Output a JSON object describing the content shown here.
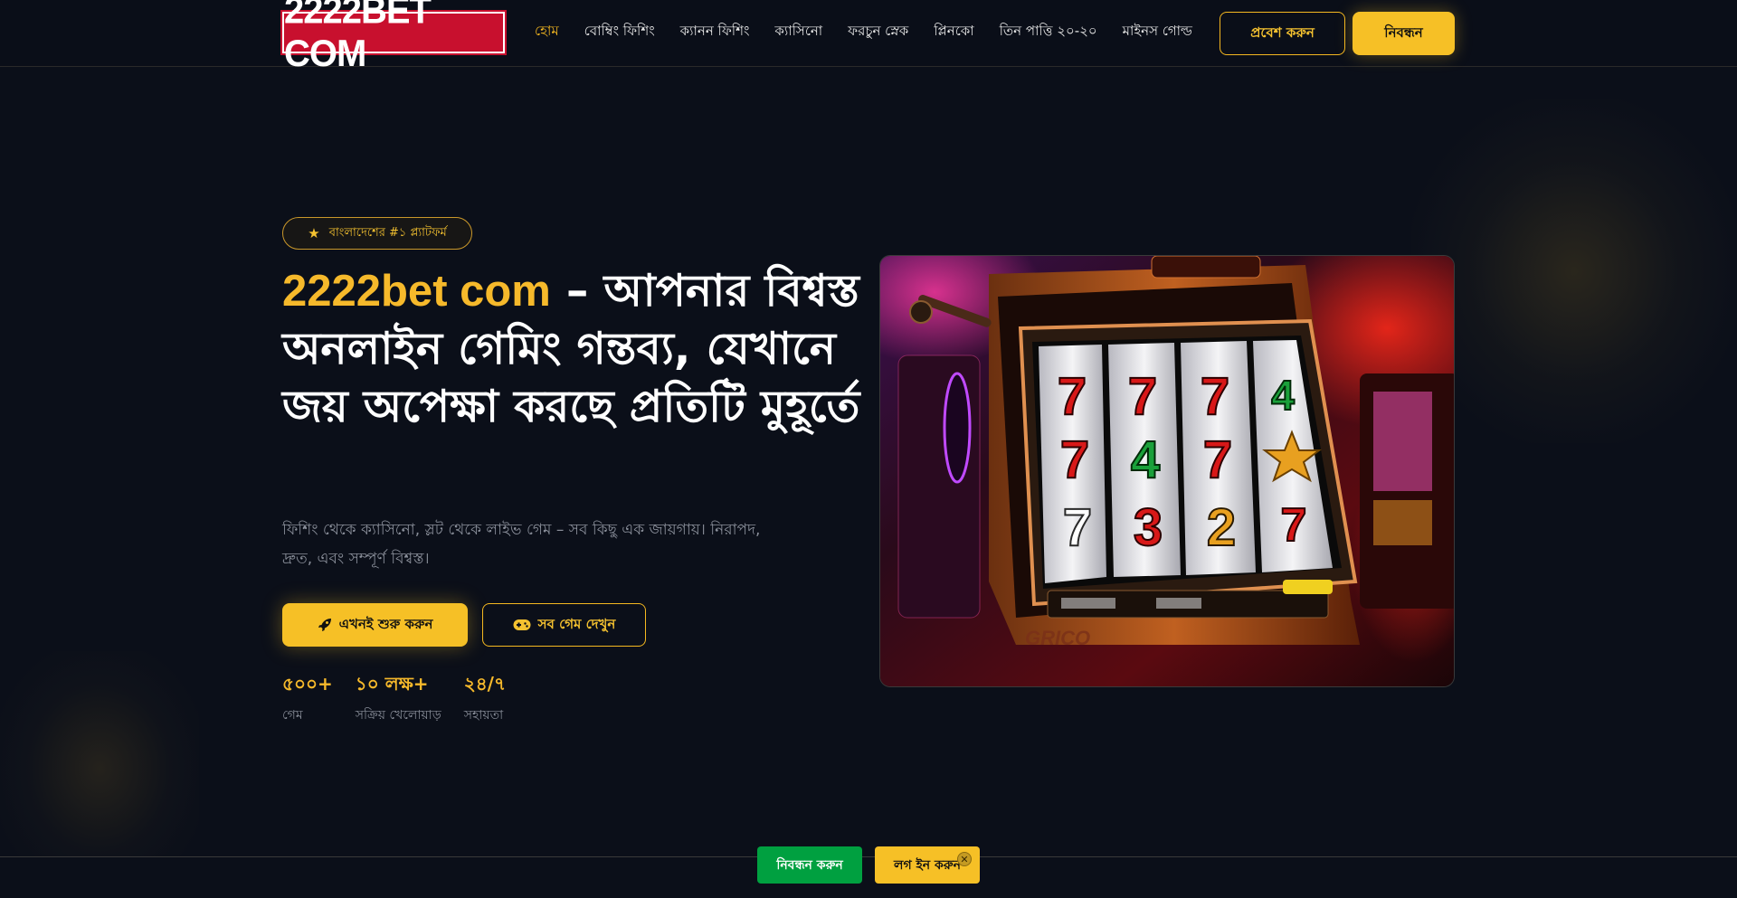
{
  "header": {
    "logo_text": "2222BET COM",
    "nav": [
      {
        "label": "হোম",
        "active": true
      },
      {
        "label": "বোম্বিং ফিশিং"
      },
      {
        "label": "ক্যানন ফিশিং"
      },
      {
        "label": "ক্যাসিনো"
      },
      {
        "label": "ফরচুন স্নেক"
      },
      {
        "label": "প্লিনকো"
      },
      {
        "label": "তিন পাত্তি ২০-২০"
      },
      {
        "label": "মাইনস গোল্ড"
      }
    ],
    "login_label": "প্রবেশ করুন",
    "register_label": "নিবন্ধন"
  },
  "hero": {
    "badge_icon": "star-icon",
    "badge_text": "বাংলাদেশের #১ প্ল্যাটফর্ম",
    "headline_brand": "2222bet com",
    "headline_rest": " – আপনার বিশ্বস্ত অনলাইন গেমিং গন্তব্য, যেখানে জয় অপেক্ষা করছে প্রতিটি মুহূর্তে",
    "subtext": "ফিশিং থেকে ক্যাসিনো, স্লট থেকে লাইভ গেম – সব কিছু এক জায়গায়। নিরাপদ, দ্রুত, এবং সম্পূর্ণ বিশ্বস্ত।",
    "cta_primary_icon": "rocket-icon",
    "cta_primary": "এখনই শুরু করুন",
    "cta_secondary_icon": "gamepad-icon",
    "cta_secondary": "সব গেম দেখুন",
    "stats": [
      {
        "value": "৫০০+",
        "label": "গেম"
      },
      {
        "value": "১০ লক্ষ+",
        "label": "সক্রিয় খেলোয়াড়"
      },
      {
        "value": "২৪/৭",
        "label": "সহায়তা"
      }
    ]
  },
  "sticky": {
    "register_label": "নিবন্ধন করুন",
    "login_label": "লগ ইন করুন",
    "close_icon": "close-icon"
  },
  "colors": {
    "background": "#0b0f19",
    "accent": "#f6c026",
    "green": "#00a040"
  }
}
